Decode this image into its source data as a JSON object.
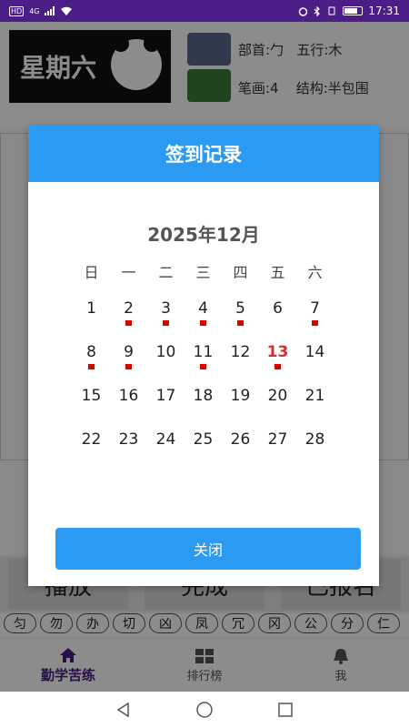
{
  "status_bar": {
    "hd": "HD",
    "network": "4G",
    "time": "17:31"
  },
  "background": {
    "day_banner": "星期六",
    "radical": "部首:勹",
    "five_elements": "五行:木",
    "strokes": "笔画:4",
    "structure": "结构:半包围",
    "buttons": [
      "播放",
      "完成",
      "已报名"
    ],
    "chars": [
      "匀",
      "勿",
      "办",
      "切",
      "凶",
      "凤",
      "冗",
      "冈",
      "公",
      "分",
      "仁"
    ]
  },
  "bottom_nav": {
    "items": [
      {
        "label": "勤学苦练",
        "icon": "home-icon",
        "active": true
      },
      {
        "label": "排行榜",
        "icon": "grid-icon",
        "active": false
      },
      {
        "label": "我",
        "icon": "bell-icon",
        "active": false
      }
    ]
  },
  "dialog": {
    "title": "签到记录",
    "month": "2025年12月",
    "weekdays": [
      "日",
      "一",
      "二",
      "三",
      "四",
      "五",
      "六"
    ],
    "weeks": [
      [
        1,
        2,
        3,
        4,
        5,
        6,
        7
      ],
      [
        8,
        9,
        10,
        11,
        12,
        13,
        14
      ],
      [
        15,
        16,
        17,
        18,
        19,
        20,
        21
      ],
      [
        22,
        23,
        24,
        25,
        26,
        27,
        28
      ]
    ],
    "signed_days": [
      2,
      3,
      4,
      5,
      7,
      8,
      9,
      11,
      13
    ],
    "today": 13,
    "close_label": "关闭"
  },
  "colors": {
    "accent": "#2b9af3",
    "status_bar": "#4a1d87",
    "signed_dot": "#e00000",
    "today": "#d32f2f"
  }
}
